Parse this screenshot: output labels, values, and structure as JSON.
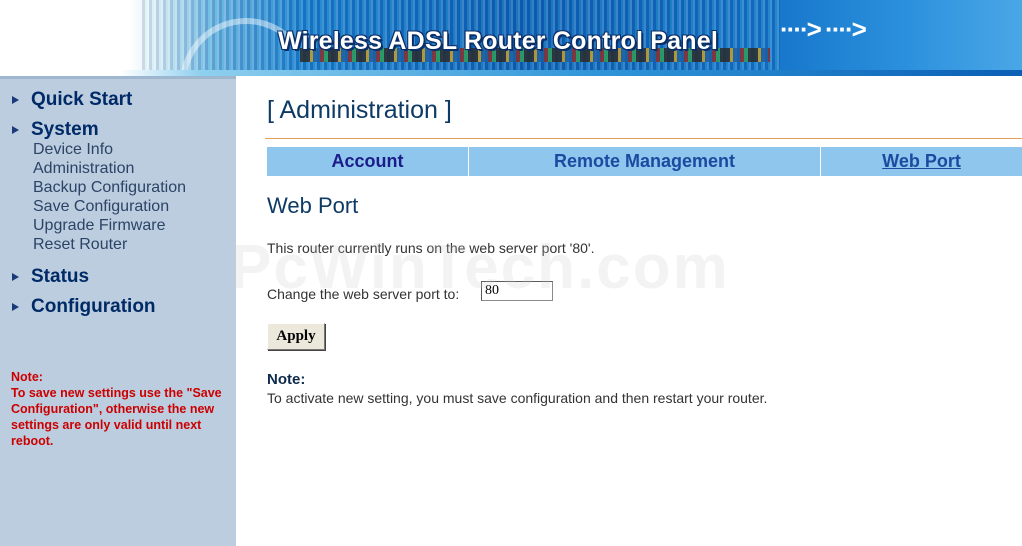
{
  "header": {
    "title": "Wireless ADSL Router Control Panel",
    "arrows": "····> ····>"
  },
  "sidebar": {
    "sections": [
      {
        "label": "Quick Start"
      },
      {
        "label": "System",
        "items": [
          "Device Info",
          "Administration",
          "Backup Configuration",
          "Save Configuration",
          "Upgrade Firmware",
          "Reset Router"
        ]
      },
      {
        "label": "Status"
      },
      {
        "label": "Configuration"
      }
    ],
    "note_title": "Note:",
    "note_text": "To save new settings use the \"Save Configuration\", otherwise the new settings are only valid until next reboot."
  },
  "main": {
    "page_title": "[ Administration ]",
    "tabs": [
      {
        "label": "Account"
      },
      {
        "label": "Remote Management"
      },
      {
        "label": "Web Port"
      }
    ],
    "section_title": "Web Port",
    "info_text": "This router currently runs on the web server port '80'.",
    "port_label": "Change the web server port to:",
    "port_value": "80",
    "apply_label": "Apply",
    "note_title": "Note:",
    "note_text": "To activate new setting, you must save configuration and then restart your router."
  },
  "watermark": "PcWinTech.com",
  "colors": {
    "sidebar_bg": "#bccddf",
    "nav_text": "#002a66",
    "note_red": "#cc0000",
    "tab_bg": "#8fc6ee",
    "title_rule": "#e7a05a"
  }
}
